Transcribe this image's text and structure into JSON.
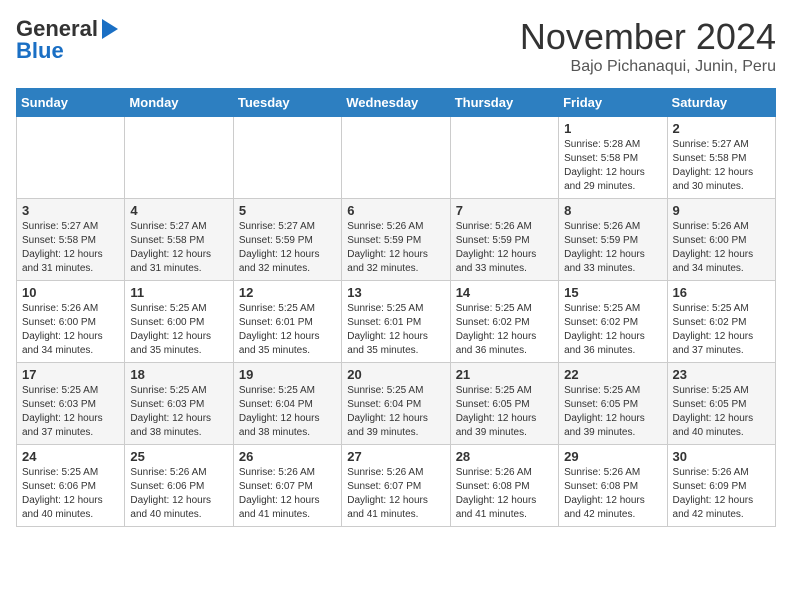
{
  "header": {
    "logo_line1": "General",
    "logo_line2": "Blue",
    "month": "November 2024",
    "location": "Bajo Pichanaqui, Junin, Peru"
  },
  "days_of_week": [
    "Sunday",
    "Monday",
    "Tuesday",
    "Wednesday",
    "Thursday",
    "Friday",
    "Saturday"
  ],
  "weeks": [
    [
      {
        "day": "",
        "info": ""
      },
      {
        "day": "",
        "info": ""
      },
      {
        "day": "",
        "info": ""
      },
      {
        "day": "",
        "info": ""
      },
      {
        "day": "",
        "info": ""
      },
      {
        "day": "1",
        "info": "Sunrise: 5:28 AM\nSunset: 5:58 PM\nDaylight: 12 hours\nand 29 minutes."
      },
      {
        "day": "2",
        "info": "Sunrise: 5:27 AM\nSunset: 5:58 PM\nDaylight: 12 hours\nand 30 minutes."
      }
    ],
    [
      {
        "day": "3",
        "info": "Sunrise: 5:27 AM\nSunset: 5:58 PM\nDaylight: 12 hours\nand 31 minutes."
      },
      {
        "day": "4",
        "info": "Sunrise: 5:27 AM\nSunset: 5:58 PM\nDaylight: 12 hours\nand 31 minutes."
      },
      {
        "day": "5",
        "info": "Sunrise: 5:27 AM\nSunset: 5:59 PM\nDaylight: 12 hours\nand 32 minutes."
      },
      {
        "day": "6",
        "info": "Sunrise: 5:26 AM\nSunset: 5:59 PM\nDaylight: 12 hours\nand 32 minutes."
      },
      {
        "day": "7",
        "info": "Sunrise: 5:26 AM\nSunset: 5:59 PM\nDaylight: 12 hours\nand 33 minutes."
      },
      {
        "day": "8",
        "info": "Sunrise: 5:26 AM\nSunset: 5:59 PM\nDaylight: 12 hours\nand 33 minutes."
      },
      {
        "day": "9",
        "info": "Sunrise: 5:26 AM\nSunset: 6:00 PM\nDaylight: 12 hours\nand 34 minutes."
      }
    ],
    [
      {
        "day": "10",
        "info": "Sunrise: 5:26 AM\nSunset: 6:00 PM\nDaylight: 12 hours\nand 34 minutes."
      },
      {
        "day": "11",
        "info": "Sunrise: 5:25 AM\nSunset: 6:00 PM\nDaylight: 12 hours\nand 35 minutes."
      },
      {
        "day": "12",
        "info": "Sunrise: 5:25 AM\nSunset: 6:01 PM\nDaylight: 12 hours\nand 35 minutes."
      },
      {
        "day": "13",
        "info": "Sunrise: 5:25 AM\nSunset: 6:01 PM\nDaylight: 12 hours\nand 35 minutes."
      },
      {
        "day": "14",
        "info": "Sunrise: 5:25 AM\nSunset: 6:02 PM\nDaylight: 12 hours\nand 36 minutes."
      },
      {
        "day": "15",
        "info": "Sunrise: 5:25 AM\nSunset: 6:02 PM\nDaylight: 12 hours\nand 36 minutes."
      },
      {
        "day": "16",
        "info": "Sunrise: 5:25 AM\nSunset: 6:02 PM\nDaylight: 12 hours\nand 37 minutes."
      }
    ],
    [
      {
        "day": "17",
        "info": "Sunrise: 5:25 AM\nSunset: 6:03 PM\nDaylight: 12 hours\nand 37 minutes."
      },
      {
        "day": "18",
        "info": "Sunrise: 5:25 AM\nSunset: 6:03 PM\nDaylight: 12 hours\nand 38 minutes."
      },
      {
        "day": "19",
        "info": "Sunrise: 5:25 AM\nSunset: 6:04 PM\nDaylight: 12 hours\nand 38 minutes."
      },
      {
        "day": "20",
        "info": "Sunrise: 5:25 AM\nSunset: 6:04 PM\nDaylight: 12 hours\nand 39 minutes."
      },
      {
        "day": "21",
        "info": "Sunrise: 5:25 AM\nSunset: 6:05 PM\nDaylight: 12 hours\nand 39 minutes."
      },
      {
        "day": "22",
        "info": "Sunrise: 5:25 AM\nSunset: 6:05 PM\nDaylight: 12 hours\nand 39 minutes."
      },
      {
        "day": "23",
        "info": "Sunrise: 5:25 AM\nSunset: 6:05 PM\nDaylight: 12 hours\nand 40 minutes."
      }
    ],
    [
      {
        "day": "24",
        "info": "Sunrise: 5:25 AM\nSunset: 6:06 PM\nDaylight: 12 hours\nand 40 minutes."
      },
      {
        "day": "25",
        "info": "Sunrise: 5:26 AM\nSunset: 6:06 PM\nDaylight: 12 hours\nand 40 minutes."
      },
      {
        "day": "26",
        "info": "Sunrise: 5:26 AM\nSunset: 6:07 PM\nDaylight: 12 hours\nand 41 minutes."
      },
      {
        "day": "27",
        "info": "Sunrise: 5:26 AM\nSunset: 6:07 PM\nDaylight: 12 hours\nand 41 minutes."
      },
      {
        "day": "28",
        "info": "Sunrise: 5:26 AM\nSunset: 6:08 PM\nDaylight: 12 hours\nand 41 minutes."
      },
      {
        "day": "29",
        "info": "Sunrise: 5:26 AM\nSunset: 6:08 PM\nDaylight: 12 hours\nand 42 minutes."
      },
      {
        "day": "30",
        "info": "Sunrise: 5:26 AM\nSunset: 6:09 PM\nDaylight: 12 hours\nand 42 minutes."
      }
    ]
  ]
}
